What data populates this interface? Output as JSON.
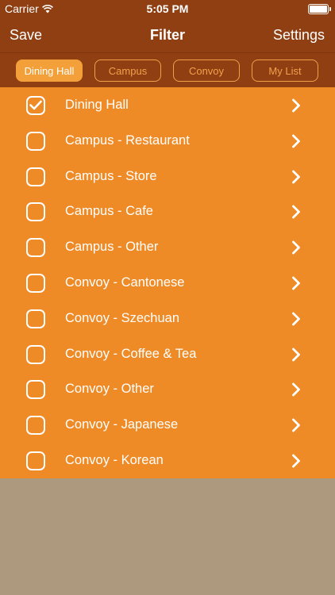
{
  "status": {
    "carrier": "Carrier",
    "time": "5:05 PM"
  },
  "nav": {
    "left": "Save",
    "title": "Filter",
    "right": "Settings"
  },
  "segments": [
    {
      "label": "Dining Hall",
      "active": true
    },
    {
      "label": "Campus",
      "active": false
    },
    {
      "label": "Convoy",
      "active": false
    },
    {
      "label": "My List",
      "active": false
    }
  ],
  "items": [
    {
      "label": "Dining Hall",
      "checked": true
    },
    {
      "label": "Campus - Restaurant",
      "checked": false
    },
    {
      "label": "Campus - Store",
      "checked": false
    },
    {
      "label": "Campus - Cafe",
      "checked": false
    },
    {
      "label": "Campus - Other",
      "checked": false
    },
    {
      "label": "Convoy - Cantonese",
      "checked": false
    },
    {
      "label": "Convoy - Szechuan",
      "checked": false
    },
    {
      "label": "Convoy - Coffee & Tea",
      "checked": false
    },
    {
      "label": "Convoy - Other",
      "checked": false
    },
    {
      "label": "Convoy - Japanese",
      "checked": false
    },
    {
      "label": "Convoy - Korean",
      "checked": false
    }
  ],
  "colors": {
    "nav_bg": "#8f3f12",
    "list_bg": "#ef8b26",
    "segment_accent": "#f4a03a",
    "empty_bg": "#ad997e"
  }
}
